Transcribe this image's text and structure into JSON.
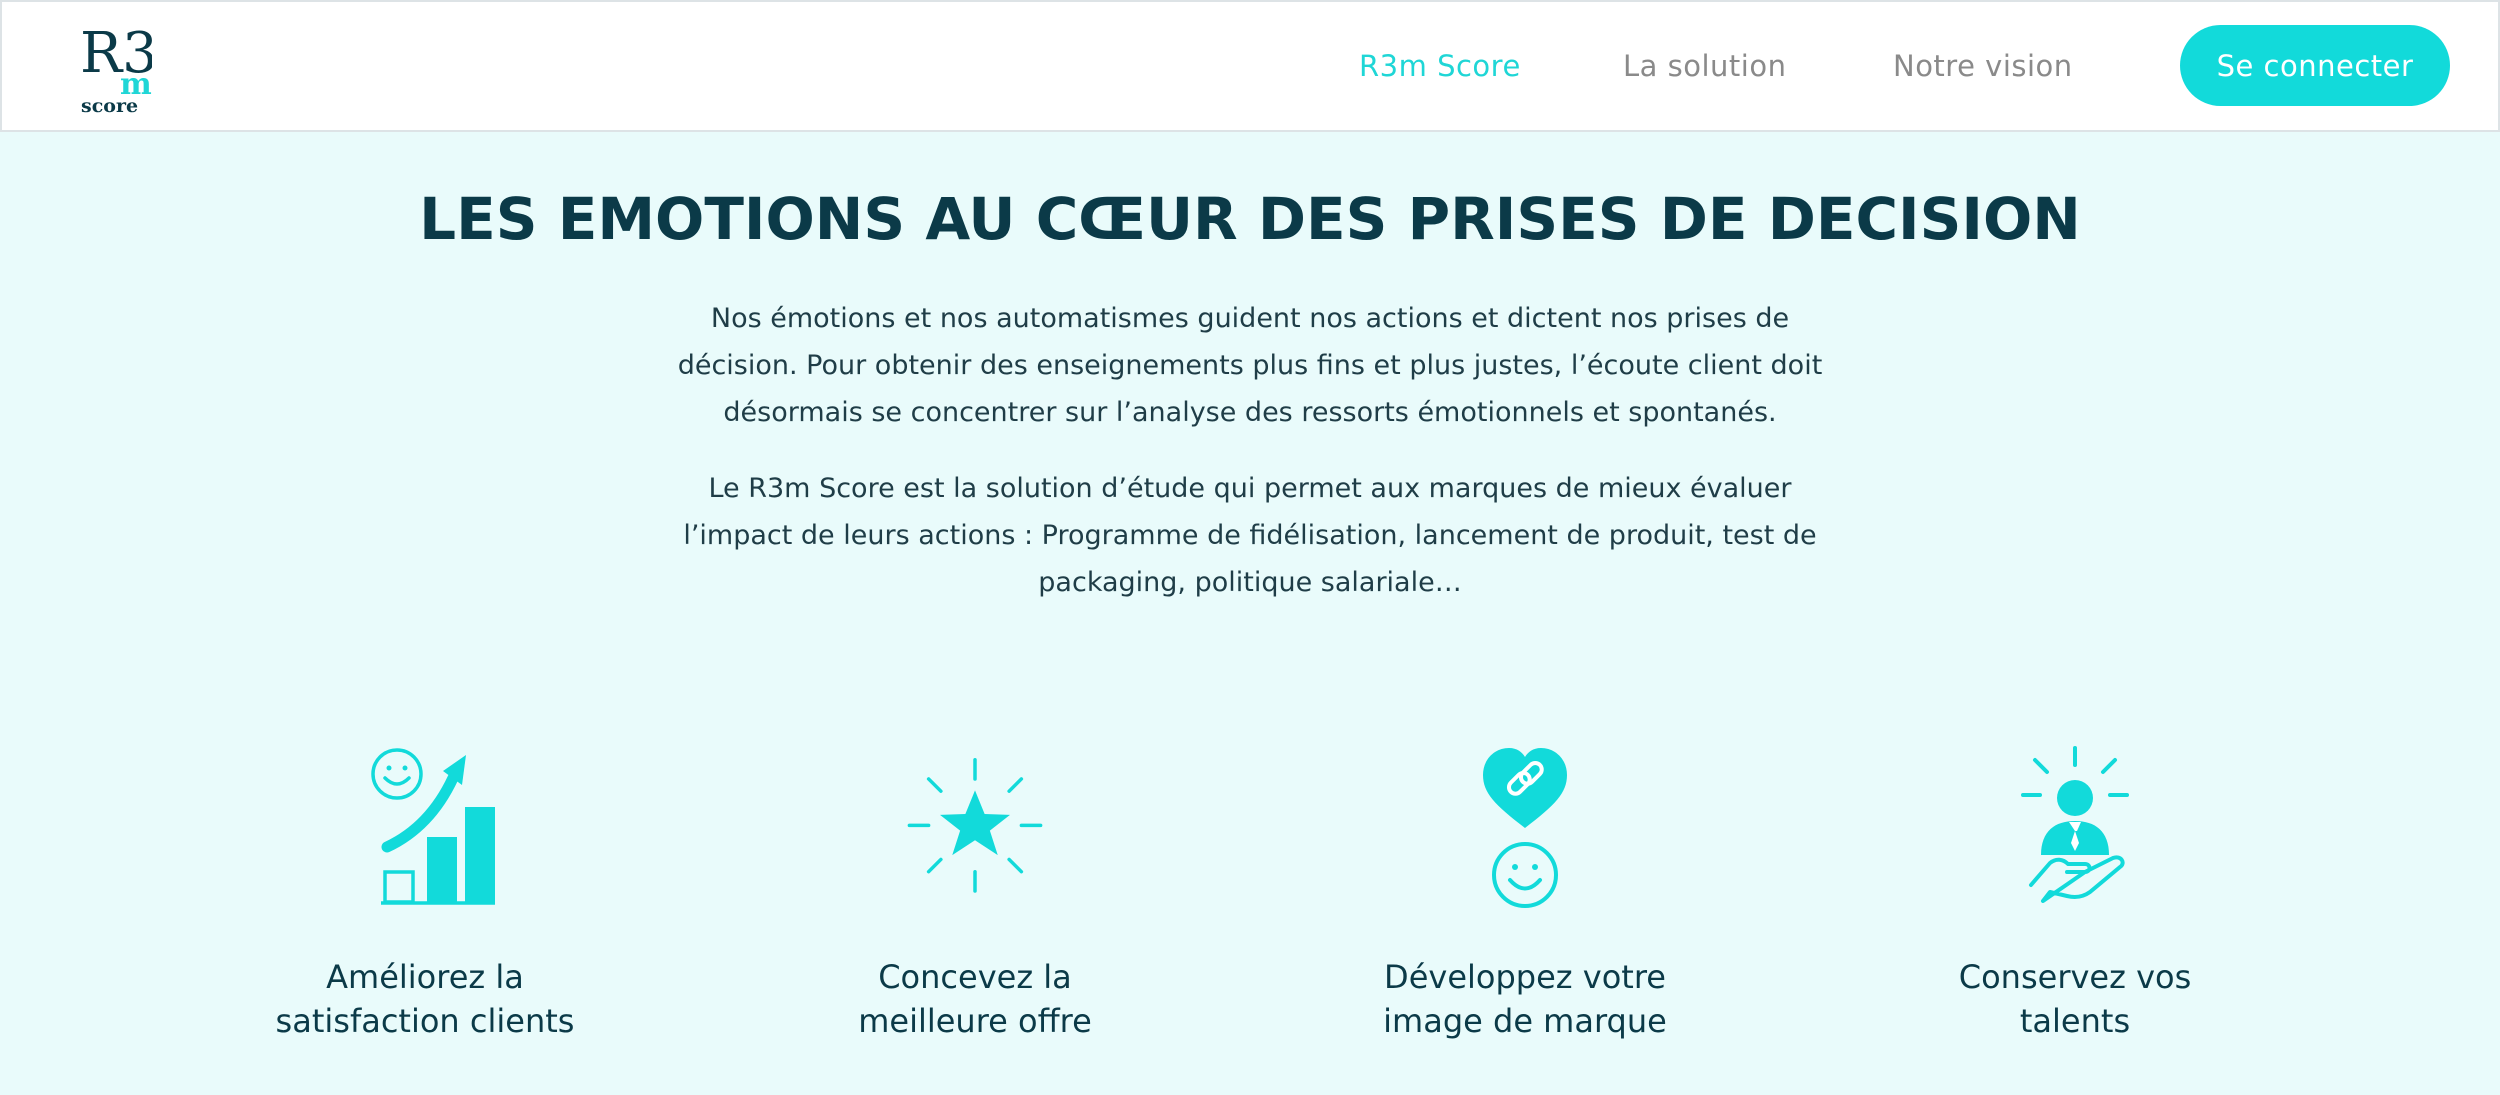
{
  "header": {
    "logo_text_top": "R3",
    "logo_text_m": "m",
    "logo_text_bottom": "score",
    "nav": [
      {
        "label": "R3m Score",
        "active": true
      },
      {
        "label": "La solution",
        "active": false
      },
      {
        "label": "Notre vision",
        "active": false
      }
    ],
    "login_label": "Se connecter"
  },
  "hero": {
    "title": "LES EMOTIONS AU CŒUR DES PRISES DE DECISION",
    "paragraph1_lines": [
      "Nos émotions et nos automatismes guident nos actions et dictent nos prises de",
      "décision. Pour obtenir des enseignements plus fins et plus justes, l’écoute client doit",
      "désormais se concentrer sur l’analyse des ressorts émotionnels et spontanés."
    ],
    "paragraph2_lines": [
      "Le R3m Score est la solution d’étude qui permet aux marques de mieux évaluer",
      "l’impact de leurs actions : Programme de fidélisation, lancement de produit, test de",
      "packaging, politique salariale…"
    ]
  },
  "features": [
    {
      "icon": "growth-chart-icon",
      "line1": "Améliorez la",
      "line2": "satisfaction clients"
    },
    {
      "icon": "star-burst-icon",
      "line1": "Concevez la",
      "line2": "meilleure offre"
    },
    {
      "icon": "heart-link-icon",
      "line1": "Développez votre",
      "line2": "image de marque"
    },
    {
      "icon": "person-hand-icon",
      "line1": "Conservez vos",
      "line2": "talents"
    }
  ],
  "colors": {
    "accent": "#12dada",
    "dark": "#0b3a48",
    "background": "#e9fbfb",
    "nav_inactive": "#8a8a8a"
  }
}
